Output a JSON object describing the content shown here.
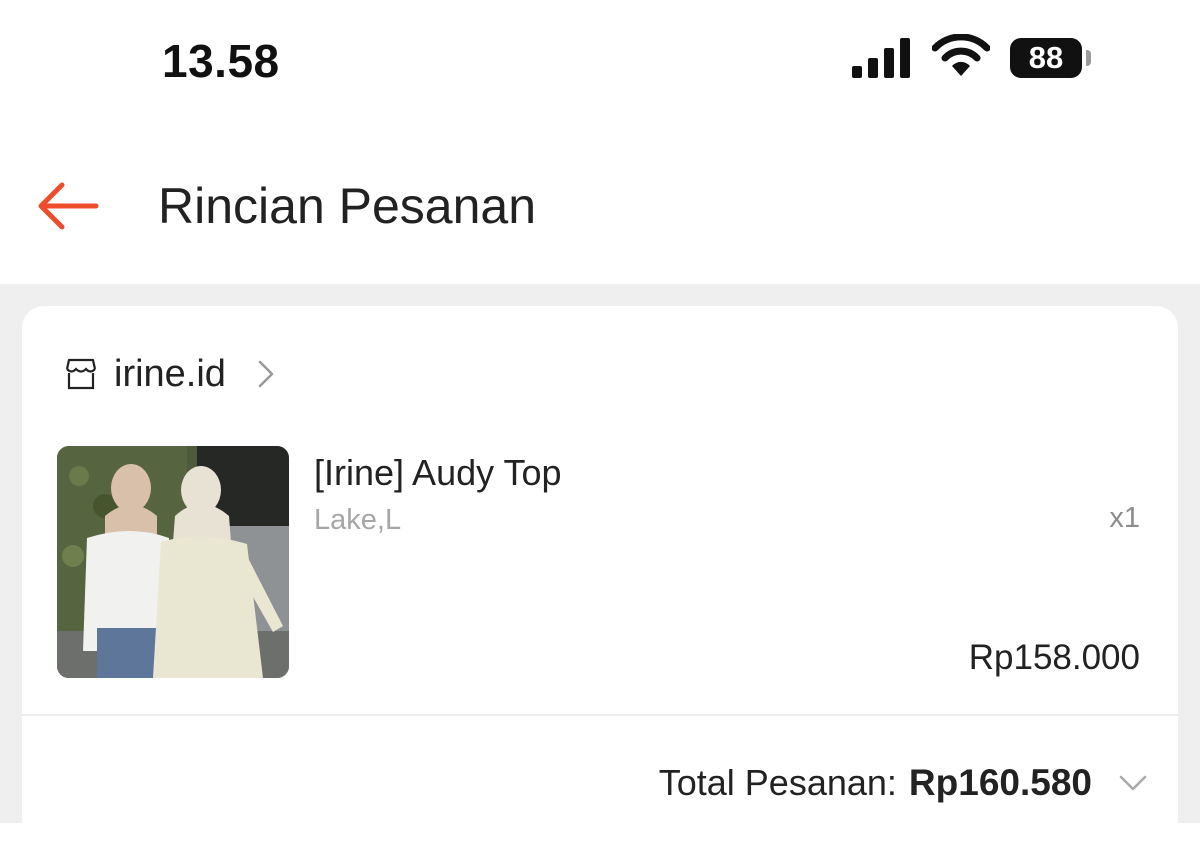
{
  "status_bar": {
    "time": "13.58",
    "battery_level": "88",
    "icons": [
      "signal-icon",
      "wifi-icon",
      "battery-icon"
    ]
  },
  "header": {
    "back_icon": "arrow-left-icon",
    "title": "Rincian Pesanan"
  },
  "colors": {
    "accent": "#ee4d2d",
    "page_background": "#efefef",
    "card_background": "#ffffff",
    "muted_text": "#a6a6a6"
  },
  "order": {
    "shop": {
      "icon": "store-icon",
      "name": "irine.id"
    },
    "items": [
      {
        "image_icon": "product-photo",
        "name": "[Irine] Audy Top",
        "variant": "Lake,L",
        "quantity": "x1",
        "price": "Rp158.000"
      }
    ],
    "total": {
      "label": "Total Pesanan:",
      "value": "Rp160.580"
    }
  }
}
